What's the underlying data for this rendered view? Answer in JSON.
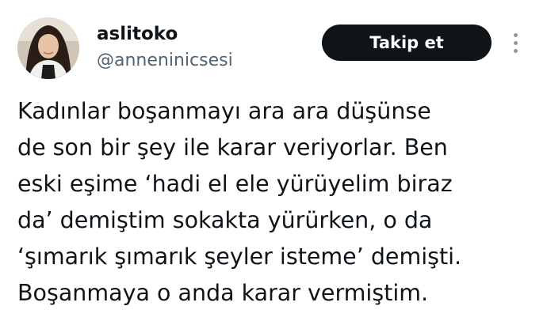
{
  "author": {
    "display_name": "aslitoko",
    "handle": "@anneninicsesi"
  },
  "actions": {
    "follow_label": "Takip et",
    "more_icon": "more-vertical-icon"
  },
  "tweet": {
    "lines": [
      "Kadınlar boşanmayı ara ara düşünse",
      "de son bir şey ile karar veriyorlar. Ben",
      "eski eşime ‘hadi el ele yürüyelim biraz",
      "da’ demiştim sokakta yürürken, o da",
      "‘şımarık şımarık şeyler isteme’ demişti.",
      "Boşanmaya o anda karar vermiştim."
    ]
  },
  "colors": {
    "text": "#0f1419",
    "secondary_text": "#536471",
    "button_bg": "#0f1419",
    "button_text": "#ffffff",
    "icon": "#8b98a5"
  }
}
